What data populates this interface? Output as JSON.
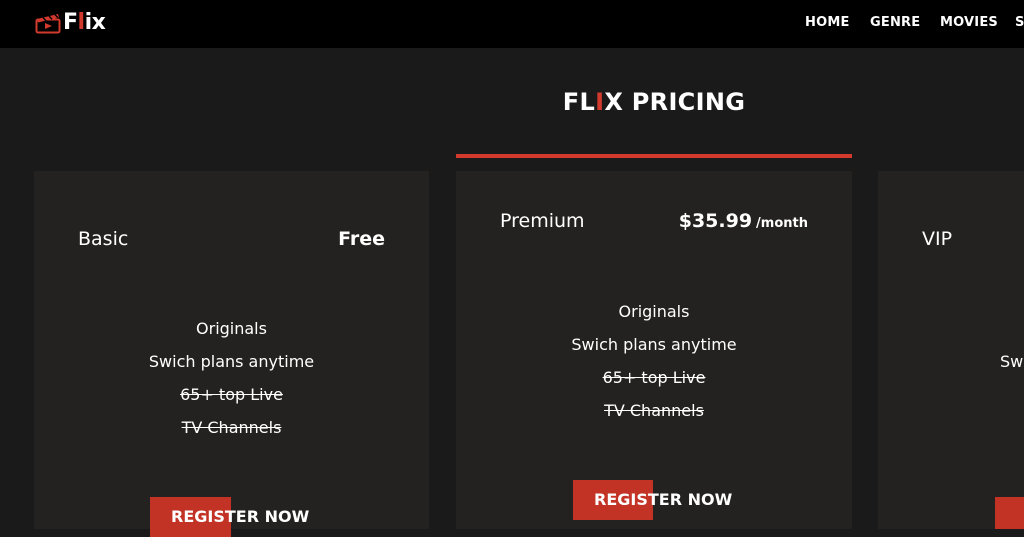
{
  "header": {
    "logo_text_prefix": "F",
    "logo_text_accent": "l",
    "logo_text_suffix": "ix",
    "nav": [
      "HOME",
      "GENRE",
      "MOVIES",
      "S"
    ]
  },
  "page": {
    "title_prefix": "FL",
    "title_accent": "I",
    "title_suffix": "X PRICING"
  },
  "plans": [
    {
      "name": "Basic",
      "price": "Free",
      "period": "",
      "features": [
        {
          "text": "Originals",
          "struck": false
        },
        {
          "text": "Swich plans anytime",
          "struck": false
        },
        {
          "text": "65+ top Live",
          "struck": true
        },
        {
          "text": "TV Channels",
          "struck": true
        }
      ],
      "button": "REGISTER NOW"
    },
    {
      "name": "Premium",
      "price": "$35.99",
      "period": "/month",
      "features": [
        {
          "text": "Originals",
          "struck": false
        },
        {
          "text": "Swich plans anytime",
          "struck": false
        },
        {
          "text": "65+ top Live",
          "struck": true
        },
        {
          "text": "TV Channels",
          "struck": true
        }
      ],
      "button": "REGISTER NOW"
    },
    {
      "name": "VIP",
      "price": "",
      "period": "",
      "features": [
        {
          "text": "Swi",
          "struck": false
        }
      ],
      "button": ""
    }
  ],
  "colors": {
    "accent": "#d23a2e",
    "button": "#c23326",
    "background": "#1b1a1a",
    "card": "#232221",
    "navbar": "#000000"
  },
  "icons": {
    "logo": "clapperboard-icon"
  }
}
